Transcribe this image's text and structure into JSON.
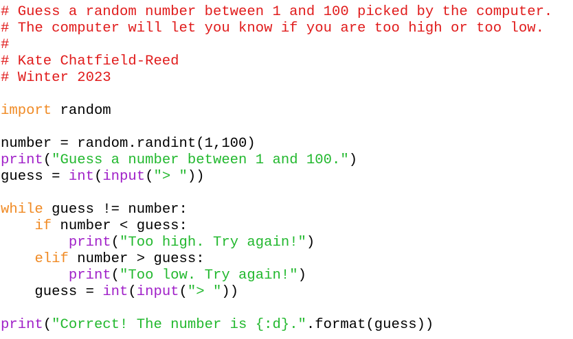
{
  "lines": [
    [
      {
        "t": "comment",
        "v": "# Guess a random number between 1 and 100 picked by the computer."
      }
    ],
    [
      {
        "t": "comment",
        "v": "# The computer will let you know if you are too high or too low."
      }
    ],
    [
      {
        "t": "comment",
        "v": "#"
      }
    ],
    [
      {
        "t": "comment",
        "v": "# Kate Chatfield-Reed"
      }
    ],
    [
      {
        "t": "comment",
        "v": "# Winter 2023"
      }
    ],
    [],
    [
      {
        "t": "keyword",
        "v": "import"
      },
      {
        "t": "code",
        "v": " random"
      }
    ],
    [],
    [
      {
        "t": "code",
        "v": "number = random.randint(1,100)"
      }
    ],
    [
      {
        "t": "builtin",
        "v": "print"
      },
      {
        "t": "code",
        "v": "("
      },
      {
        "t": "string",
        "v": "\"Guess a number between 1 and 100.\""
      },
      {
        "t": "code",
        "v": ")"
      }
    ],
    [
      {
        "t": "code",
        "v": "guess = "
      },
      {
        "t": "builtin",
        "v": "int"
      },
      {
        "t": "code",
        "v": "("
      },
      {
        "t": "builtin",
        "v": "input"
      },
      {
        "t": "code",
        "v": "("
      },
      {
        "t": "string",
        "v": "\"> \""
      },
      {
        "t": "code",
        "v": "))"
      }
    ],
    [],
    [
      {
        "t": "keyword",
        "v": "while"
      },
      {
        "t": "code",
        "v": " guess != number:"
      }
    ],
    [
      {
        "t": "code",
        "v": "    "
      },
      {
        "t": "keyword",
        "v": "if"
      },
      {
        "t": "code",
        "v": " number < guess:"
      }
    ],
    [
      {
        "t": "code",
        "v": "        "
      },
      {
        "t": "builtin",
        "v": "print"
      },
      {
        "t": "code",
        "v": "("
      },
      {
        "t": "string",
        "v": "\"Too high. Try again!\""
      },
      {
        "t": "code",
        "v": ")"
      }
    ],
    [
      {
        "t": "code",
        "v": "    "
      },
      {
        "t": "keyword",
        "v": "elif"
      },
      {
        "t": "code",
        "v": " number > guess:"
      }
    ],
    [
      {
        "t": "code",
        "v": "        "
      },
      {
        "t": "builtin",
        "v": "print"
      },
      {
        "t": "code",
        "v": "("
      },
      {
        "t": "string",
        "v": "\"Too low. Try again!\""
      },
      {
        "t": "code",
        "v": ")"
      }
    ],
    [
      {
        "t": "code",
        "v": "    guess = "
      },
      {
        "t": "builtin",
        "v": "int"
      },
      {
        "t": "code",
        "v": "("
      },
      {
        "t": "builtin",
        "v": "input"
      },
      {
        "t": "code",
        "v": "("
      },
      {
        "t": "string",
        "v": "\"> \""
      },
      {
        "t": "code",
        "v": "))"
      }
    ],
    [],
    [
      {
        "t": "builtin",
        "v": "print"
      },
      {
        "t": "code",
        "v": "("
      },
      {
        "t": "string",
        "v": "\"Correct! The number is {:d}.\""
      },
      {
        "t": "code",
        "v": ".format(guess))"
      }
    ]
  ],
  "colors": {
    "comment": "#e01b1b",
    "keyword": "#f08a24",
    "builtin": "#a020c8",
    "string": "#22b82e",
    "code": "#000000",
    "background": "#ffffff"
  }
}
